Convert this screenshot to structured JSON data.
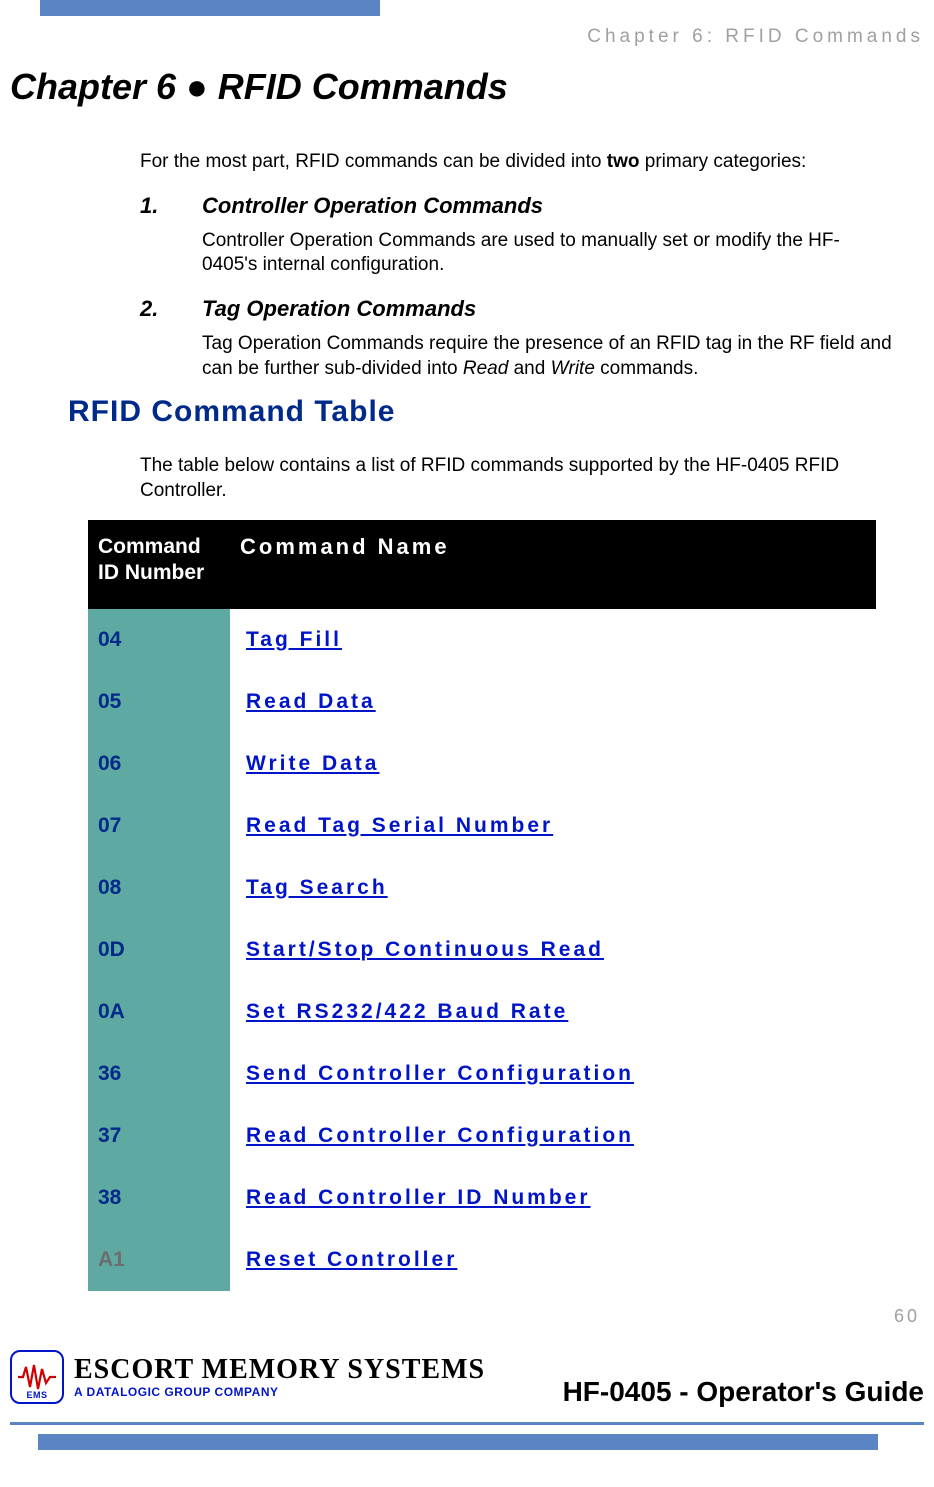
{
  "header": {
    "running_head": "Chapter 6: RFID Commands",
    "chapter_title": "Chapter 6 ● RFID Commands"
  },
  "intro": {
    "line1_pre": "For the most part, RFID commands can be divided into ",
    "line1_bold": "two",
    "line1_post": " primary categories:"
  },
  "categories": [
    {
      "num": "1.",
      "head": "Controller Operation Commands",
      "body": "Controller Operation Commands are used to manually set or modify the HF-0405's internal configuration."
    },
    {
      "num": "2.",
      "head": "Tag Operation Commands",
      "body_pre": "Tag Operation Commands require the presence of an RFID tag in the RF field and can be further sub-divided into ",
      "body_i1": "Read",
      "body_mid": " and ",
      "body_i2": "Write",
      "body_post": " commands."
    }
  ],
  "section": {
    "heading": "RFID Command Table",
    "intro": "The table below contains a list of RFID commands supported by the HF-0405 RFID Controller."
  },
  "table": {
    "headers": {
      "id": "Command ID Number",
      "name": "Command Name"
    },
    "rows": [
      {
        "id": "04",
        "name": "Tag Fill"
      },
      {
        "id": "05",
        "name": "Read Data"
      },
      {
        "id": "06",
        "name": "Write Data"
      },
      {
        "id": "07",
        "name": "Read Tag Serial Number"
      },
      {
        "id": "08",
        "name": "Tag Search"
      },
      {
        "id": "0D",
        "name": "Start/Stop Continuous Read"
      },
      {
        "id": "0A",
        "name": "Set RS232/422 Baud Rate"
      },
      {
        "id": "36",
        "name": "Send Controller Configuration"
      },
      {
        "id": "37",
        "name": "Read Controller Configuration"
      },
      {
        "id": "38",
        "name": "Read Controller ID Number"
      },
      {
        "id": "A1",
        "name": "Reset Controller"
      }
    ]
  },
  "page_number": "60",
  "footer": {
    "brand_main": "ESCORT MEMORY SYSTEMS",
    "brand_sub": "A DATALOGIC GROUP COMPANY",
    "badge_label": "EMS",
    "doc_title": "HF-0405 - Operator's Guide"
  }
}
